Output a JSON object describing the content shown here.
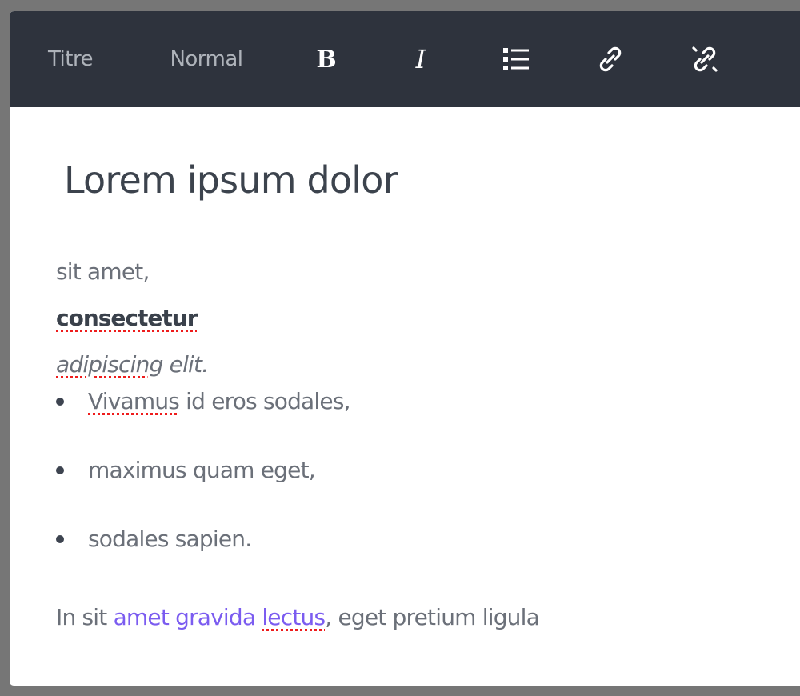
{
  "toolbar": {
    "heading_label": "Titre",
    "normal_label": "Normal",
    "bold_label": "B",
    "italic_label": "I",
    "icons": {
      "bullet_list": "bullet-list-icon",
      "link": "link-icon",
      "unlink": "unlink-icon"
    }
  },
  "content": {
    "heading": "Lorem ipsum dolor",
    "line1": "sit amet,",
    "line2_bold": "consectetur",
    "line3_italic_misspelled": "adipiscing",
    "line3_italic_rest": " elit.",
    "bullets": [
      {
        "misspelled": "Vivamus",
        "text": " id eros sodales,"
      },
      {
        "misspelled": "",
        "text": "maximus quam eget,"
      },
      {
        "misspelled": "",
        "text": "sodales sapien."
      }
    ],
    "last_para": {
      "prefix": "In sit ",
      "link_text": "amet gravida ",
      "link_misspelled": "lectus",
      "suffix": ", eget pretium ligula"
    }
  },
  "colors": {
    "toolbar_bg": "#2e333d",
    "backdrop": "#767676",
    "heading_text": "#3c434d",
    "body_text": "#6b7079",
    "link": "#7b5cf0",
    "spellcheck": "#ee1c1c"
  }
}
